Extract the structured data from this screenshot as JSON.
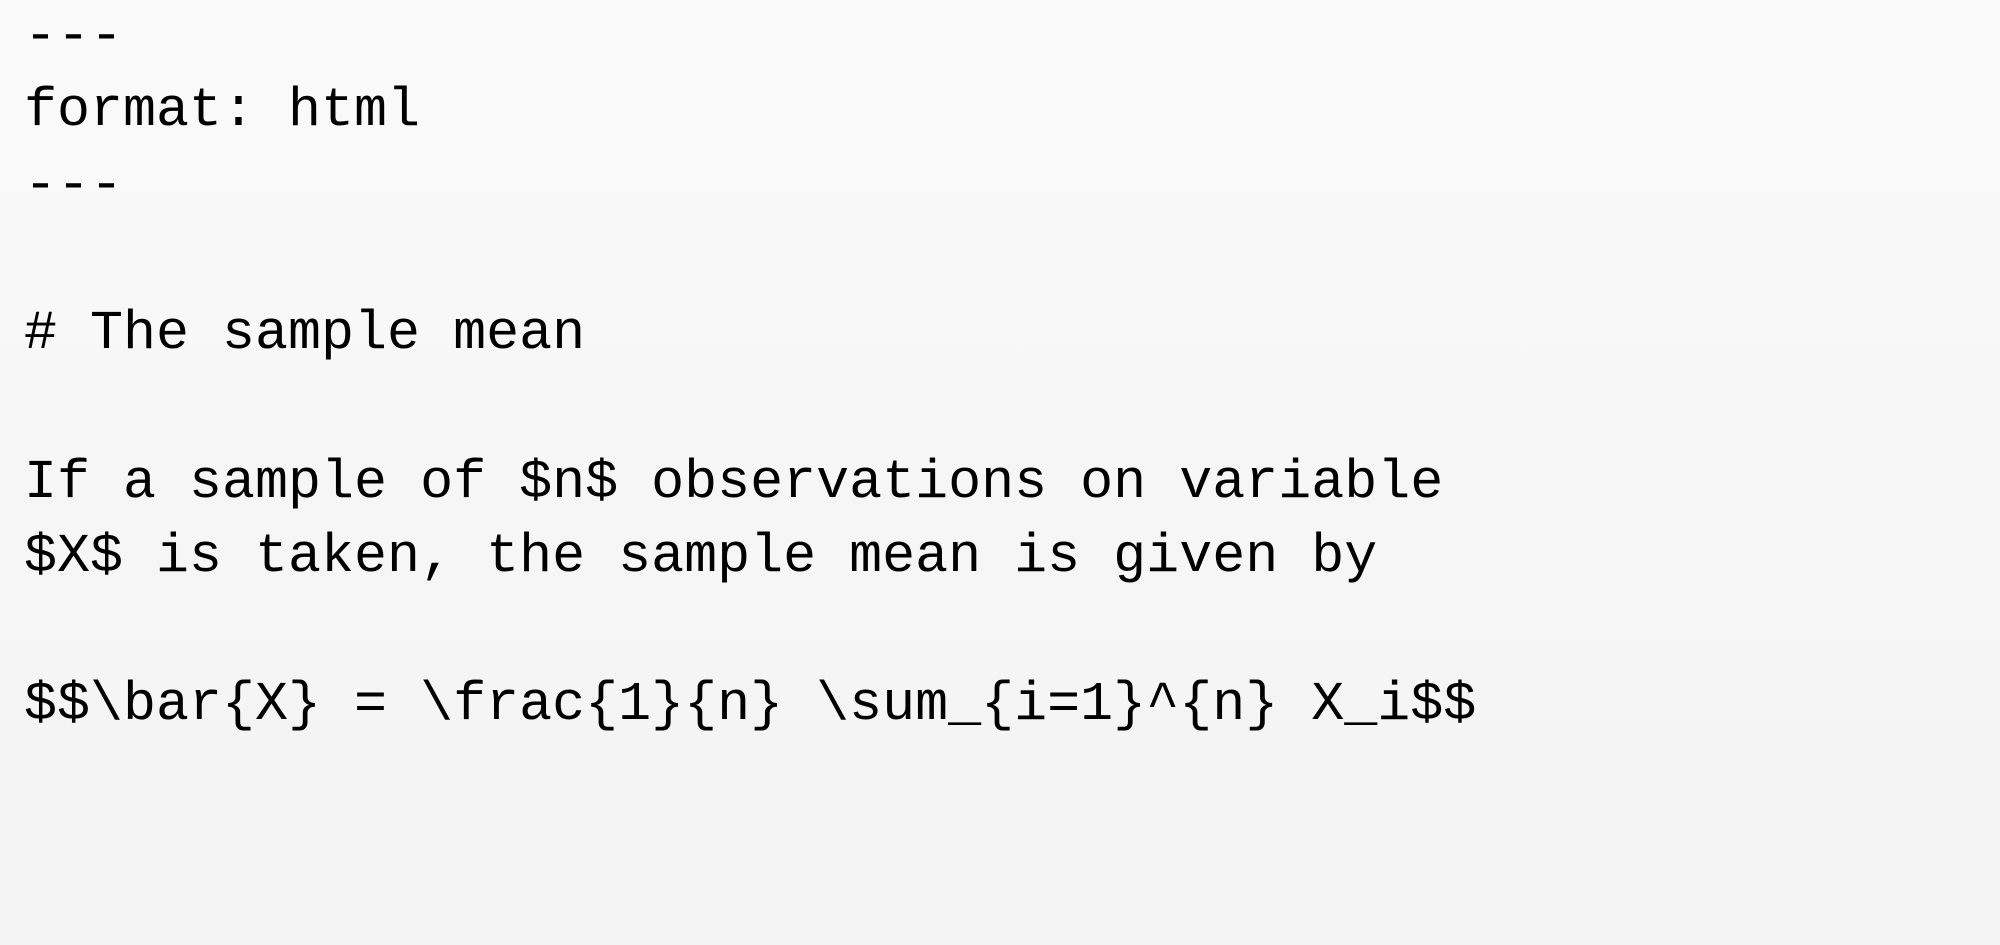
{
  "lines": {
    "l1": "---",
    "l2": "format: html",
    "l3": "---",
    "l4": "",
    "l5": "# The sample mean",
    "l6": "",
    "l7": "If a sample of $n$ observations on variable",
    "l8": "$X$ is taken, the sample mean is given by",
    "l9": "",
    "l10": "$$\\bar{X} = \\frac{1}{n} \\sum_{i=1}^{n} X_i$$"
  }
}
